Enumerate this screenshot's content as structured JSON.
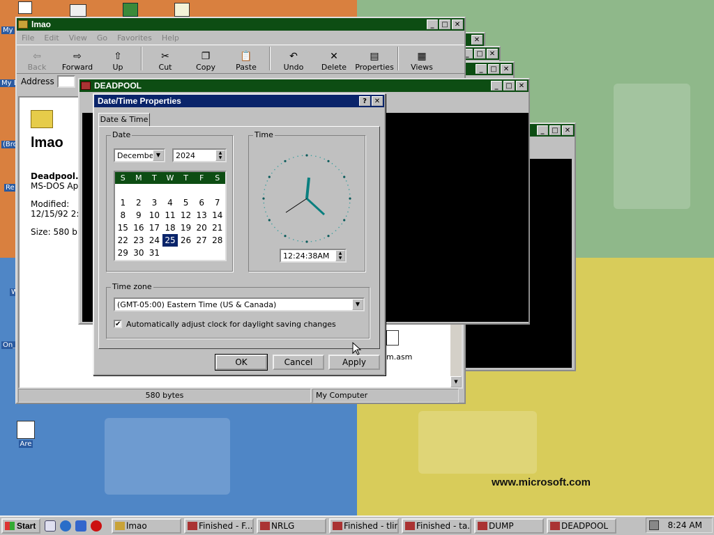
{
  "desktop": {
    "watermark": "www.microsoft.com",
    "labels": [
      "My",
      "My D",
      "(Bro",
      "Re",
      "W",
      "On_",
      "Are"
    ]
  },
  "explorer_windows": [
    {
      "title": "lmao"
    }
  ],
  "explorer": {
    "menu": [
      "File",
      "Edit",
      "View",
      "Go",
      "Favorites",
      "Help"
    ],
    "toolbar": [
      "Back",
      "Forward",
      "Up",
      "Cut",
      "Copy",
      "Paste",
      "Undo",
      "Delete",
      "Properties",
      "Views"
    ],
    "address_label": "Address",
    "folder_name": "lmao",
    "file_name": "Deadpool.c",
    "file_type": "MS-DOS Ap",
    "modified_label": "Modified:",
    "modified_value": "12/15/92 2:",
    "size_label": "Size: 580 b",
    "status_size": "580 bytes",
    "status_location": "My Computer",
    "file_fragment": "m.asm"
  },
  "deadpool_window": {
    "title": "DEADPOOL"
  },
  "dialog": {
    "title": "Date/Time Properties",
    "tab": "Date & Time",
    "date_group": "Date",
    "time_group": "Time",
    "month": "December",
    "year": "2024",
    "weekdays": [
      "S",
      "M",
      "T",
      "W",
      "T",
      "F",
      "S"
    ],
    "days": [
      "",
      "",
      "",
      "",
      "",
      "",
      "",
      "1",
      "2",
      "3",
      "4",
      "5",
      "6",
      "7",
      "8",
      "9",
      "10",
      "11",
      "12",
      "13",
      "14",
      "15",
      "16",
      "17",
      "18",
      "19",
      "20",
      "21",
      "22",
      "23",
      "24",
      "25",
      "26",
      "27",
      "28",
      "29",
      "30",
      "31"
    ],
    "selected_day": "25",
    "time": "12:24:38AM",
    "timezone_group": "Time zone",
    "timezone": "(GMT-05:00) Eastern Time (US & Canada)",
    "dst_label": "Automatically adjust clock for daylight saving changes",
    "dst_checked": true,
    "ok": "OK",
    "cancel": "Cancel",
    "apply": "Apply"
  },
  "taskbar": {
    "start": "Start",
    "items": [
      "lmao",
      "Finished - F...",
      "NRLG",
      "Finished - tlink",
      "Finished - ta...",
      "DUMP",
      "DEADPOOL"
    ],
    "clock": "8:24 AM"
  },
  "colors": {
    "active_title": "#0a246a",
    "inactive_title": "#0d4d13",
    "face": "#c0c0c0"
  }
}
